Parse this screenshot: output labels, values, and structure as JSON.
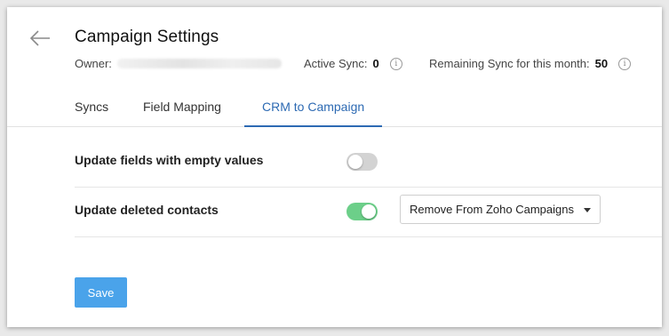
{
  "header": {
    "title": "Campaign Settings",
    "owner_label": "Owner:",
    "active_sync_label": "Active Sync:",
    "active_sync_value": "0",
    "remaining_label": "Remaining Sync for this month:",
    "remaining_value": "50",
    "info_glyph": "i"
  },
  "tabs": [
    {
      "label": "Syncs",
      "active": false
    },
    {
      "label": "Field Mapping",
      "active": false
    },
    {
      "label": "CRM to Campaign",
      "active": true
    }
  ],
  "settings": {
    "empty_values": {
      "label": "Update fields with empty values",
      "enabled": false
    },
    "deleted_contacts": {
      "label": "Update deleted contacts",
      "enabled": true,
      "action_selected": "Remove From Zoho Campaigns"
    }
  },
  "footer": {
    "save_label": "Save"
  },
  "colors": {
    "accent": "#2d6ab3",
    "toggle_on": "#6ccf89",
    "toggle_off": "#d3d3d3",
    "save_button": "#4aa3ea"
  },
  "icons": {
    "back": "arrow-left-icon",
    "info": "info-icon",
    "dropdown": "caret-down-icon"
  }
}
